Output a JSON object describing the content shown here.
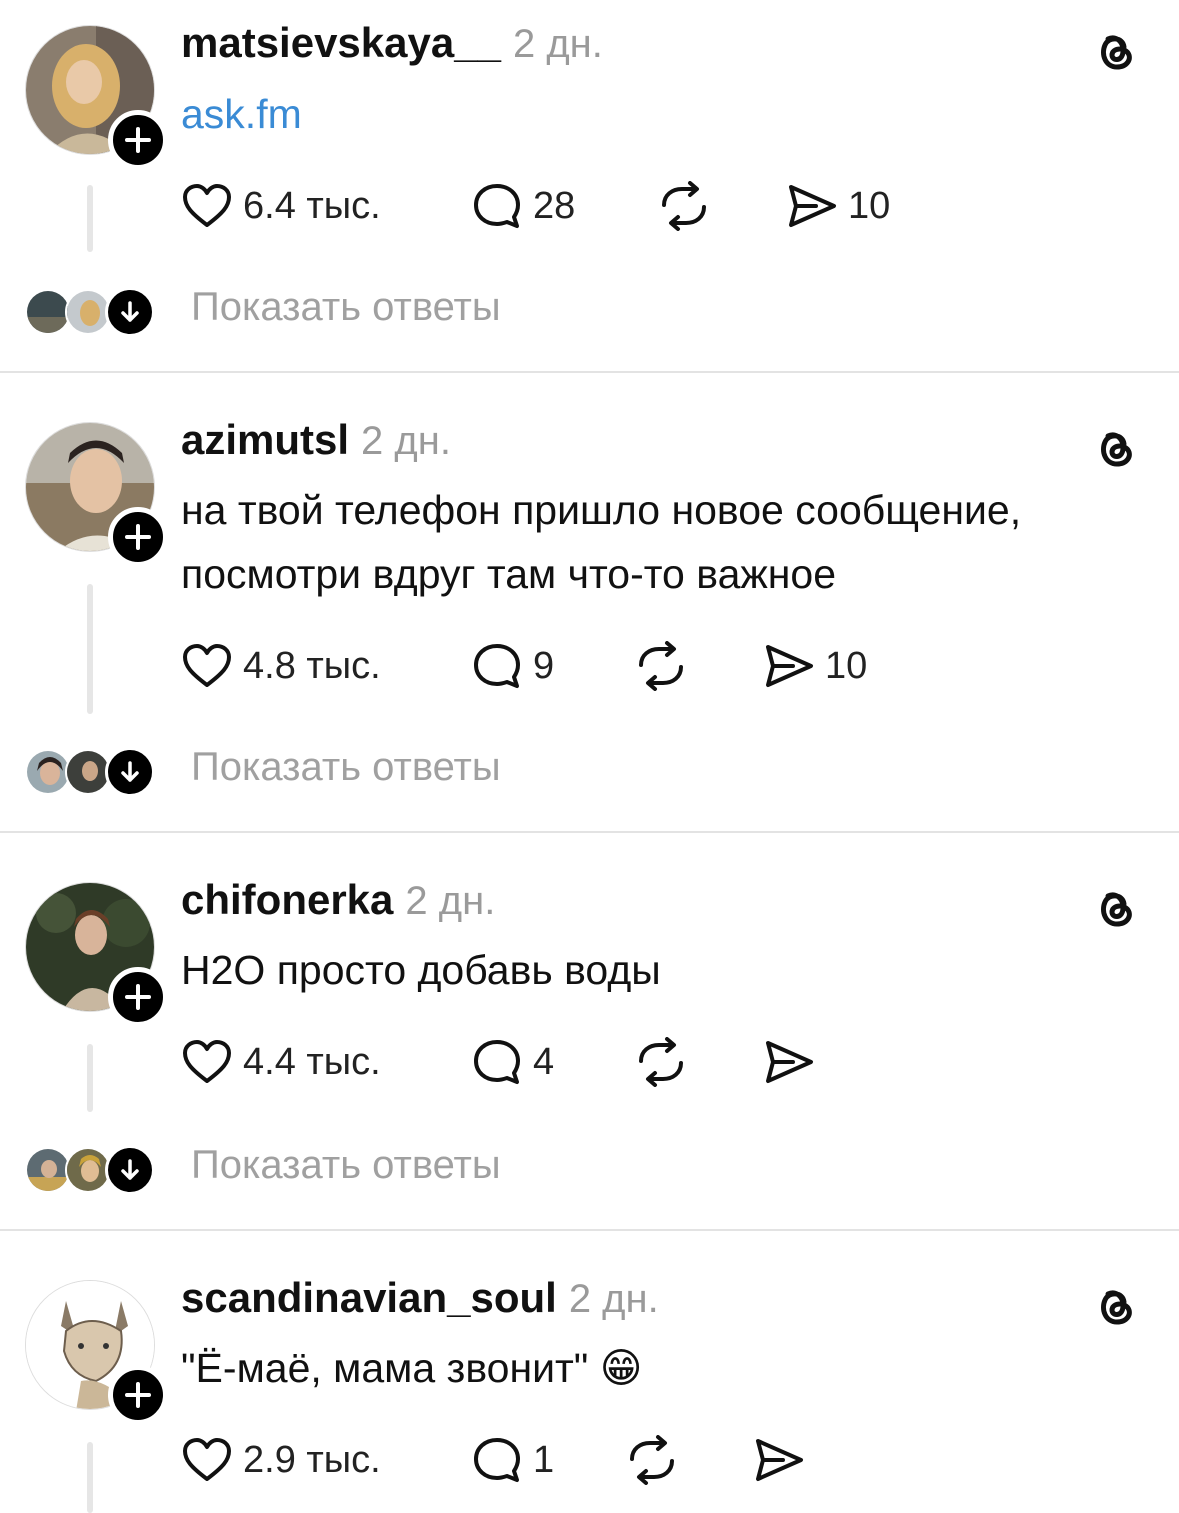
{
  "posts": [
    {
      "username": "matsievskaya__",
      "time": "2 дн.",
      "content_lines": [
        "ask.fm"
      ],
      "content_is_link": true,
      "likes": "6.4 тыс.",
      "comments": "28",
      "reposts": "",
      "shares": "10",
      "show_replies": "Показать ответы"
    },
    {
      "username": "azimutsl",
      "time": "2 дн.",
      "content_lines": [
        "на твой телефон пришло новое сообщение,",
        "посмотри вдруг там что-то важное"
      ],
      "content_is_link": false,
      "likes": "4.8 тыс.",
      "comments": "9",
      "reposts": "",
      "shares": "10",
      "show_replies": "Показать ответы"
    },
    {
      "username": "chifonerka",
      "time": "2 дн.",
      "content_lines": [
        "Н2О просто добавь воды"
      ],
      "content_is_link": false,
      "likes": "4.4 тыс.",
      "comments": "4",
      "reposts": "",
      "shares": "",
      "show_replies": "Показать ответы"
    },
    {
      "username": "scandinavian_soul",
      "time": "2 дн.",
      "content_lines": [
        "\"Ё-маё, мама звонит\" 😁"
      ],
      "content_is_link": false,
      "likes": "2.9 тыс.",
      "comments": "1",
      "reposts": "",
      "shares": "",
      "show_replies": ""
    }
  ],
  "icons": {
    "like": "heart-icon",
    "comment": "comment-bubble-icon",
    "repost": "repost-icon",
    "share": "send-icon",
    "app": "threads-logo-icon",
    "follow": "plus-icon",
    "expand": "arrow-down-icon"
  },
  "colors": {
    "link": "#3a8bd5",
    "meta_gray": "#9a9a9a",
    "divider": "#e3e3e3"
  }
}
